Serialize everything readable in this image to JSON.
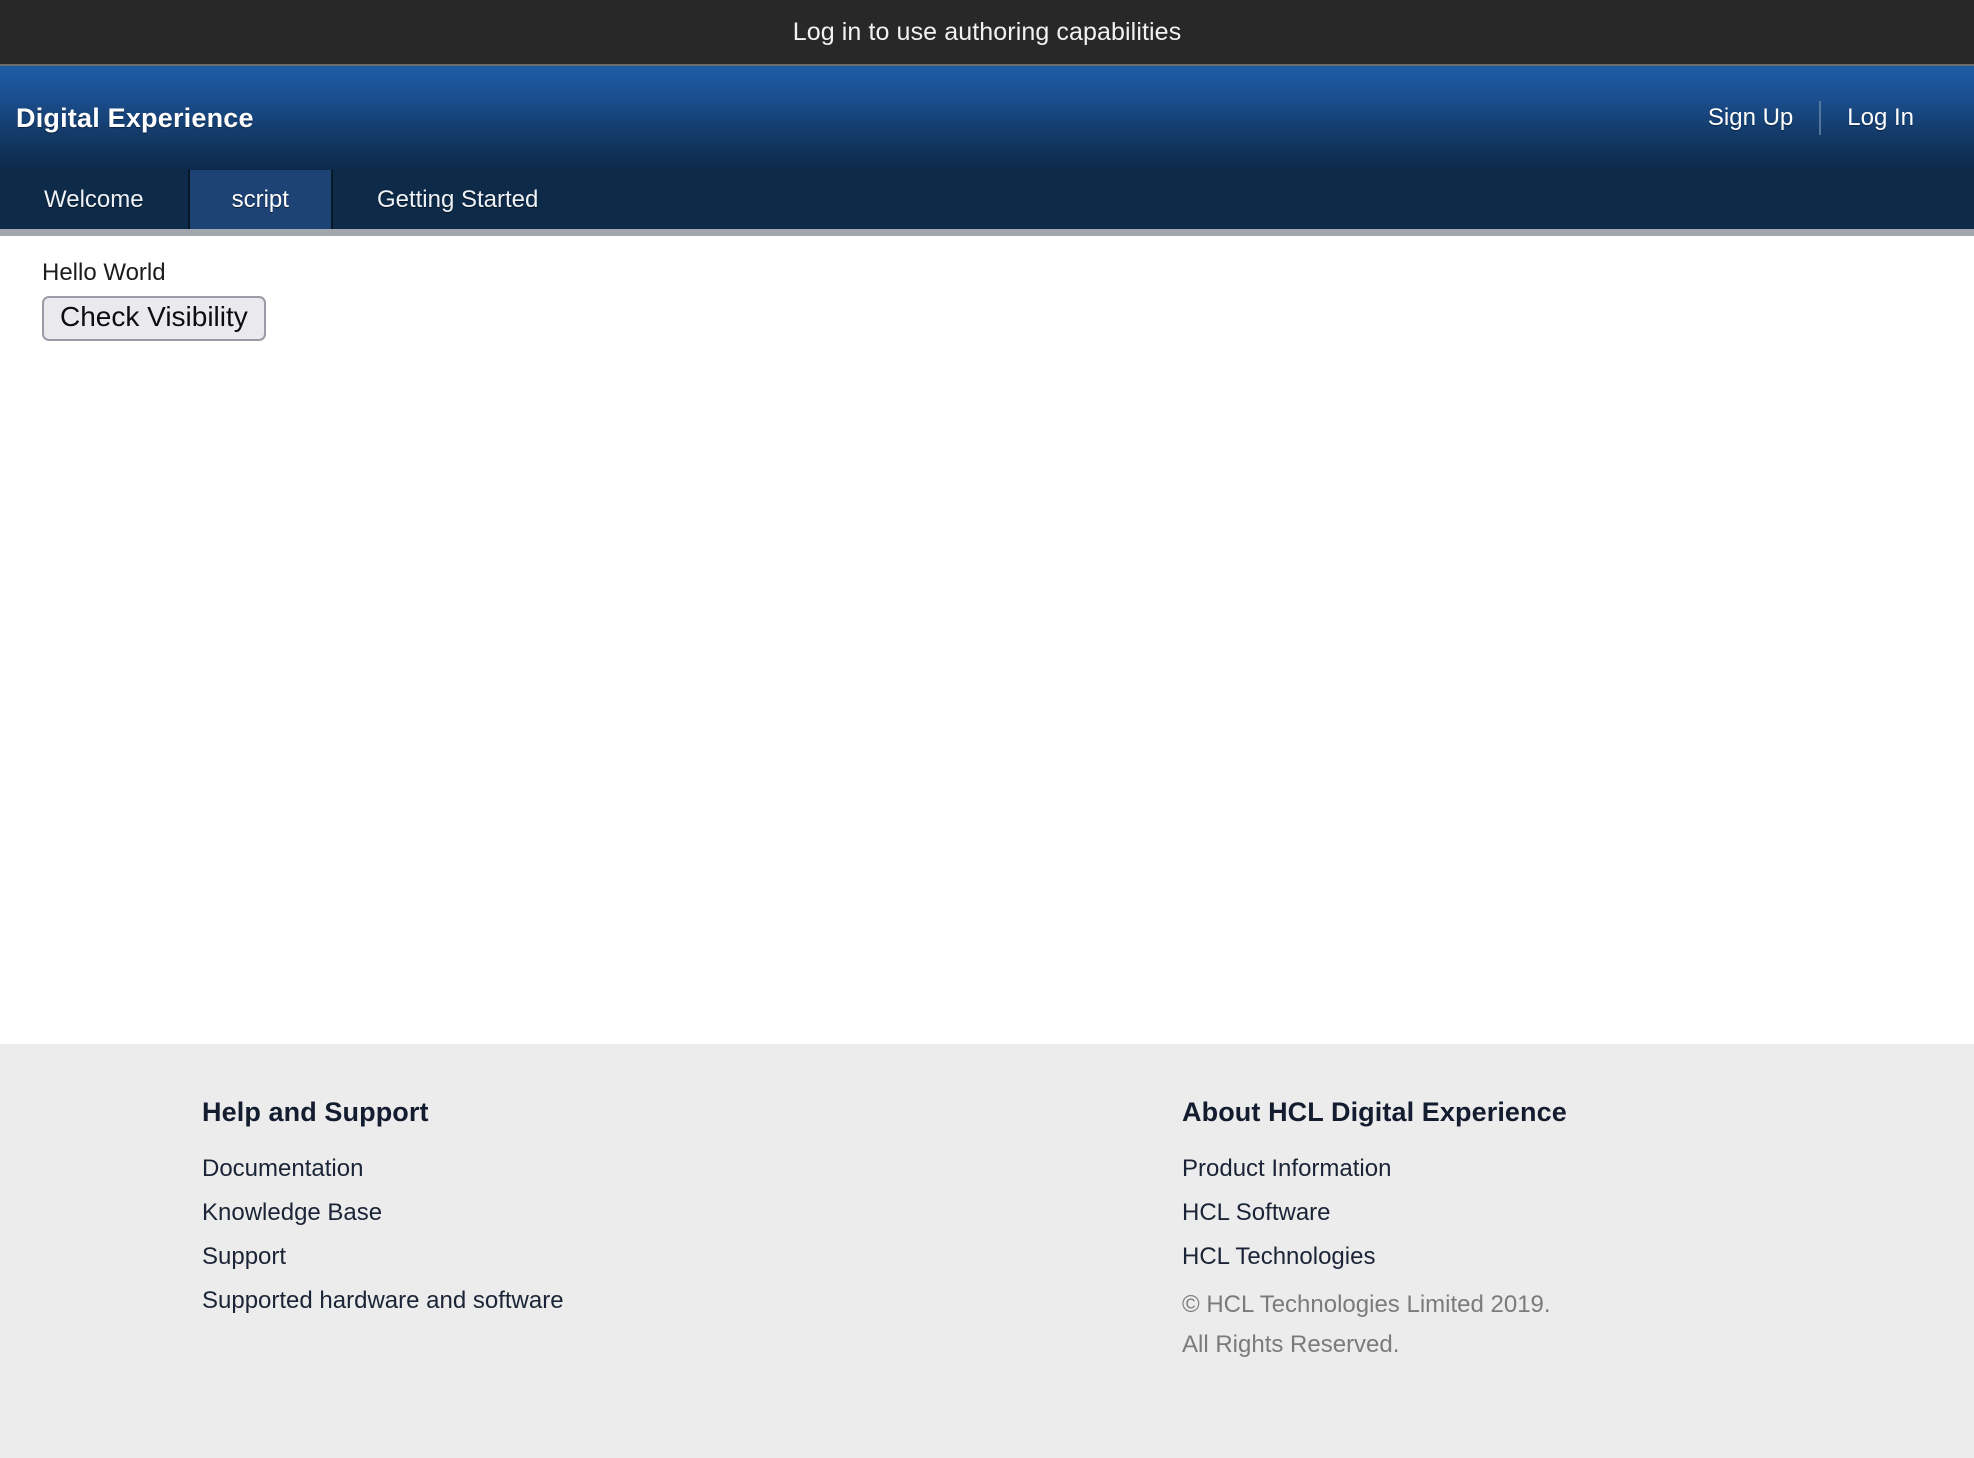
{
  "banner": {
    "message": "Log in to use authoring capabilities"
  },
  "header": {
    "brand": "Digital Experience",
    "sign_up": "Sign Up",
    "log_in": "Log In"
  },
  "nav": {
    "tabs": [
      {
        "label": "Welcome",
        "selected": false
      },
      {
        "label": "script",
        "selected": true
      },
      {
        "label": "Getting Started",
        "selected": false
      }
    ]
  },
  "main": {
    "hello_text": "Hello World",
    "check_visibility_button": "Check Visibility"
  },
  "footer": {
    "help": {
      "heading": "Help and Support",
      "links": [
        "Documentation",
        "Knowledge Base",
        "Support",
        "Supported hardware and software"
      ]
    },
    "about": {
      "heading": "About HCL Digital Experience",
      "links": [
        "Product Information",
        "HCL Software",
        "HCL Technologies"
      ],
      "copyright_line1": "© HCL Technologies Limited 2019.",
      "copyright_line2": "All Rights Reserved."
    }
  },
  "colors": {
    "banner_bg": "#282828",
    "header_top": "#1d5da6",
    "header_bottom": "#0d2a4a",
    "nav_bg": "#0e2a49",
    "nav_selected": "#1d4375",
    "nav_underline": "#a2a6ad",
    "footer_bg": "#ececec",
    "footer_heading": "#141d30",
    "copyright": "#7b7b7b"
  }
}
